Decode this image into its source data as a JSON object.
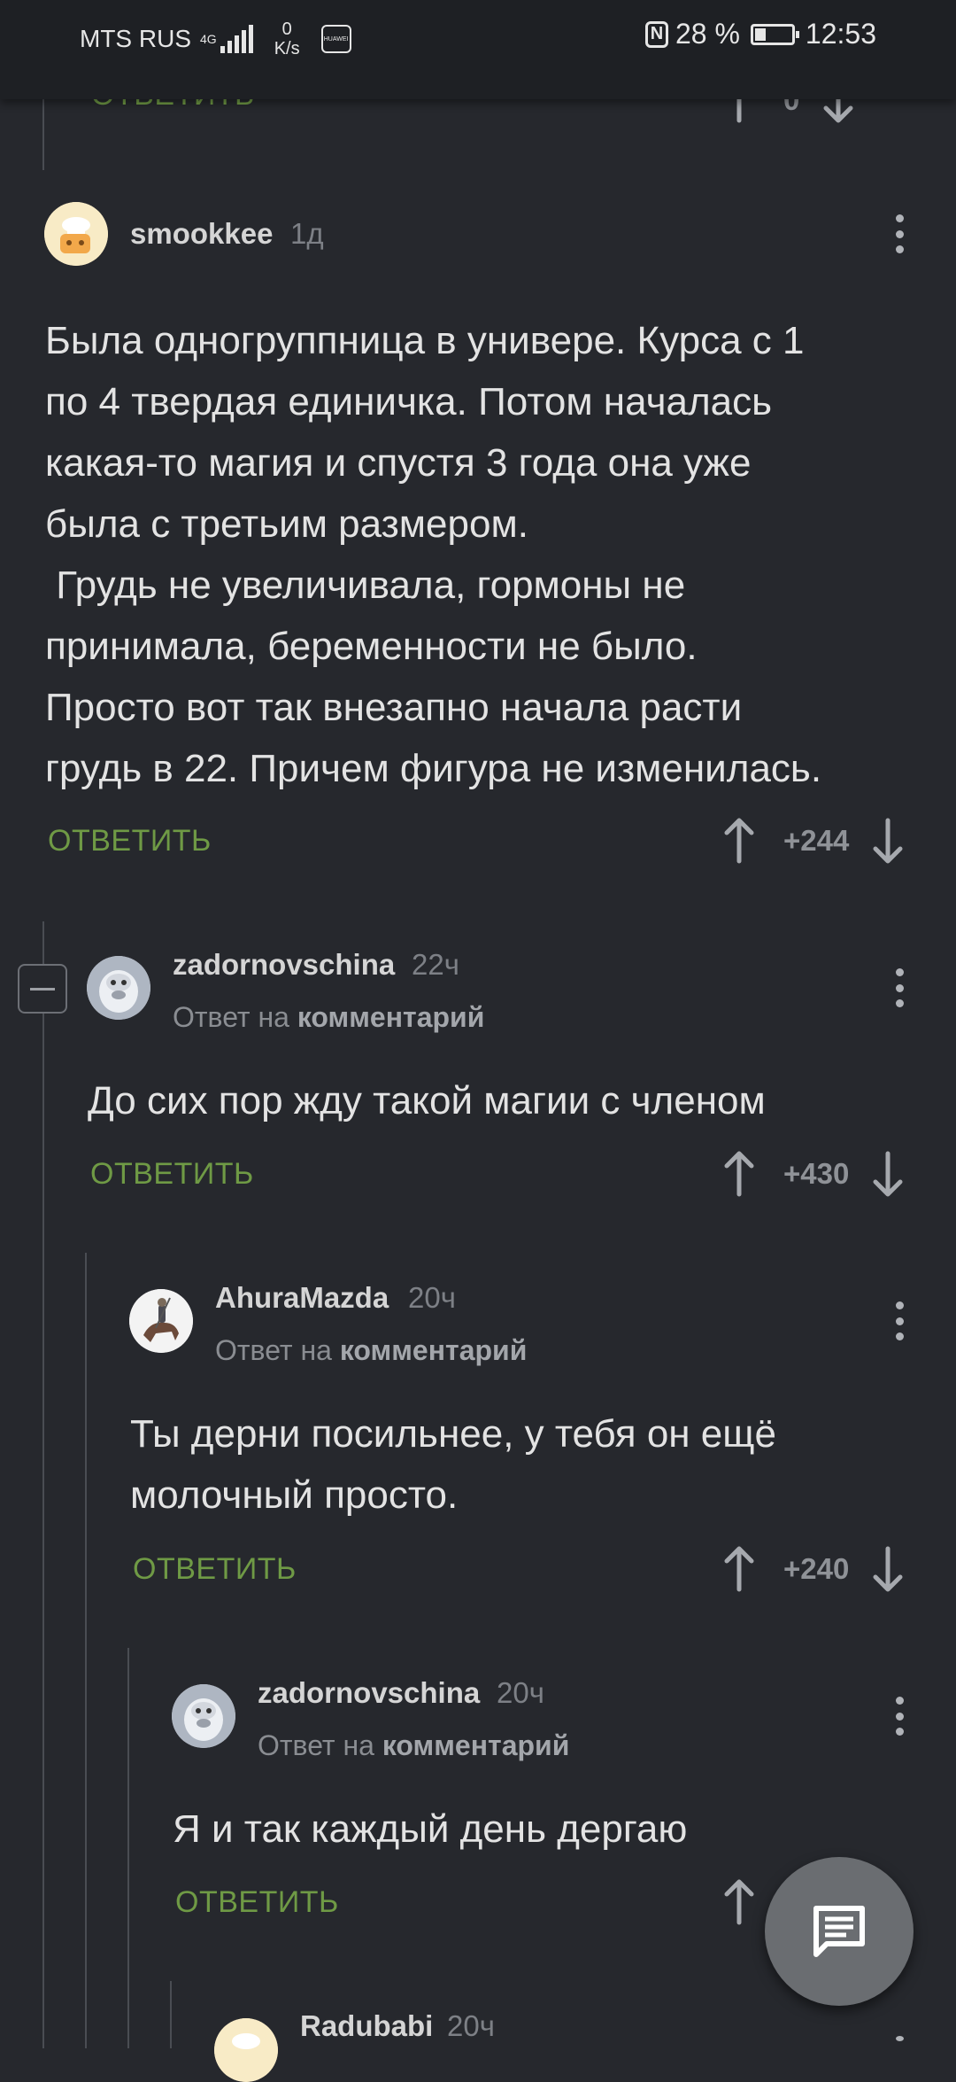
{
  "status_bar": {
    "carrier": "MTS RUS",
    "network": "4G",
    "speed_value": "0",
    "speed_unit": "K/s",
    "hw_label": "HUAWEI",
    "battery": "28 %",
    "time": "12:53"
  },
  "top_partial": {
    "reply_label": "ОТВЕТИТЬ"
  },
  "comments": [
    {
      "username": "smookkee",
      "time": "1д",
      "text": "Была одногруппница в универе. Курса с 1\nпо 4 твердая единичка. Потом началась\nкакая-то магия и спустя 3 года она уже\nбыла с третьим размером.\n Грудь не увеличивала, гормоны не\nпринимала, беременности не было.\nПросто вот так внезапно начала расти\nгрудь в 22. Причем фигура не изменилась.",
      "reply_label": "ОТВЕТИТЬ",
      "score": "+244"
    },
    {
      "username": "zadornovschina",
      "time": "22ч",
      "reply_prefix": "Ответ на",
      "reply_link": "комментарий",
      "text": "До сих пор жду такой магии с членом",
      "reply_label": "ОТВЕТИТЬ",
      "score": "+430"
    },
    {
      "username": "AhuraMazda",
      "time": "20ч",
      "reply_prefix": "Ответ на",
      "reply_link": "комментарий",
      "text": "Ты дерни посильнее, у тебя он ещё\nмолочный просто.",
      "reply_label": "ОТВЕТИТЬ",
      "score": "+240"
    },
    {
      "username": "zadornovschina",
      "time": "20ч",
      "reply_prefix": "Ответ на",
      "reply_link": "комментарий",
      "text": "Я и так каждый день дергаю",
      "reply_label": "ОТВЕТИТЬ",
      "score": ""
    },
    {
      "username": "Radubabi",
      "time": "20ч"
    }
  ],
  "icons": {
    "vote_up": "arrow-up-icon",
    "vote_down": "arrow-down-icon",
    "menu": "more-vertical-icon",
    "fab": "comment-icon"
  },
  "colors": {
    "background": "#26282d",
    "accent_green": "#6f9a45"
  }
}
